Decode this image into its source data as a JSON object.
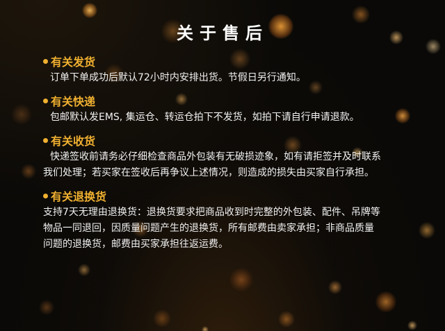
{
  "title": "关于售后",
  "accent_color": "#f0b030",
  "sections": [
    {
      "heading": "有关发货",
      "lines": [
        "订单下单成功后默认72小时内安排出货。节假日另行通知。"
      ]
    },
    {
      "heading": "有关快递",
      "lines": [
        "包邮默认发EMS, 集运仓、转运仓拍下不发货，如拍下请自行申请退款。"
      ]
    },
    {
      "heading": "有关收货",
      "lines": [
        "快递签收前请务必仔细检查商品外包装有无破损迹象，如有请拒签并及时联系",
        "我们处理；若买家在签收后再争议上述情况，则造成的损失由买家自行承担。"
      ]
    },
    {
      "heading": "有关退换货",
      "lines": [
        "支持7天无理由退换货：退换货要求把商品收到时完整的外包装、配件、吊牌等",
        "物品一同退回，因质量问题产生的退换货，所有邮费由卖家承担；非商品质量",
        "问题的退换货，邮费由买家承担往返运费。"
      ]
    }
  ]
}
